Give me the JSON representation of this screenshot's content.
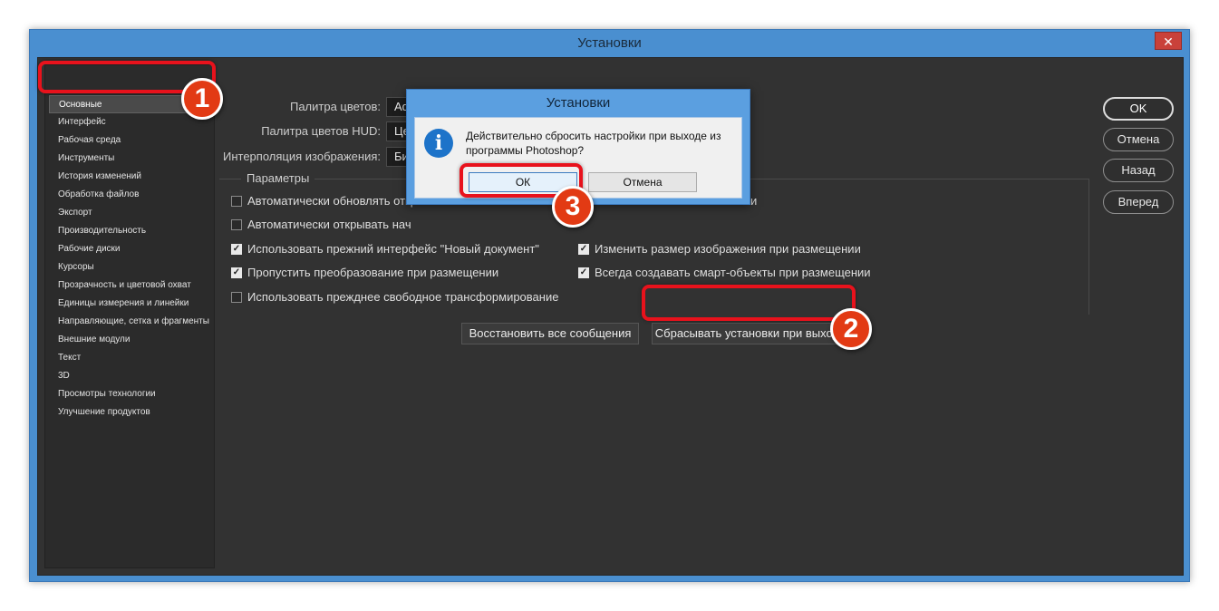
{
  "window": {
    "title": "Установки",
    "close": "✕"
  },
  "sidebar": {
    "items": [
      {
        "label": "Основные",
        "active": true
      },
      {
        "label": "Интерфейс"
      },
      {
        "label": "Рабочая среда"
      },
      {
        "label": "Инструменты"
      },
      {
        "label": "История изменений"
      },
      {
        "label": "Обработка файлов"
      },
      {
        "label": "Экспорт"
      },
      {
        "label": "Производительность"
      },
      {
        "label": "Рабочие диски"
      },
      {
        "label": "Курсоры"
      },
      {
        "label": "Прозрачность и цветовой охват"
      },
      {
        "label": "Единицы измерения и линейки"
      },
      {
        "label": "Направляющие, сетка и фрагменты"
      },
      {
        "label": "Внешние модули"
      },
      {
        "label": "Текст"
      },
      {
        "label": "3D"
      },
      {
        "label": "Просмотры технологии"
      },
      {
        "label": "Улучшение продуктов"
      }
    ]
  },
  "form": {
    "color_picker_label": "Палитра цветов:",
    "color_picker_value": "Adobe",
    "hud_picker_label": "Палитра цветов HUD:",
    "hud_picker_value": "Це",
    "interp_label": "Интерполяция изображения:",
    "interp_value": "Би"
  },
  "options": {
    "title": "Параметры",
    "items": [
      {
        "label": "Автоматически обновлять откр",
        "checked": false
      },
      {
        "label": "Автоматически открывать нач",
        "checked": false
      },
      {
        "label": "Использовать прежний интерфейс \"Новый документ\"",
        "checked": true
      },
      {
        "label": "Пропустить преобразование при размещении",
        "checked": true
      },
      {
        "label": "Использовать прежднее свободное трансформирование",
        "checked": false
      },
      {
        "label": "и",
        "checked": false
      },
      {
        "label": "Изменить размер изображения при размещении",
        "checked": true
      },
      {
        "label": "Всегда создавать смарт-объекты при размещении",
        "checked": true
      }
    ]
  },
  "buttons": {
    "restore_messages": "Восстановить все сообщения",
    "reset_on_quit": "Сбрасывать установки при выходе"
  },
  "right_buttons": {
    "ok": "OK",
    "cancel": "Отмена",
    "back": "Назад",
    "next": "Вперед"
  },
  "dialog": {
    "title": "Установки",
    "icon": "i",
    "message": "Действительно сбросить настройки при выходе из программы Photoshop?",
    "ok": "ОК",
    "cancel": "Отмена"
  },
  "annotations": {
    "step1": "1",
    "step2": "2",
    "step3": "3",
    "highlight_color": "#e8121c"
  }
}
